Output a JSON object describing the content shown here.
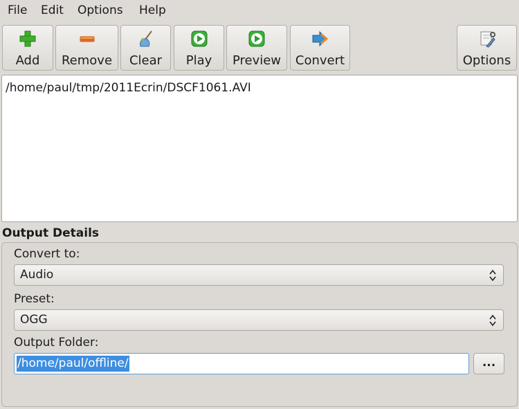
{
  "menubar": {
    "items": [
      "File",
      "Edit",
      "Options",
      "Help"
    ]
  },
  "toolbar": {
    "add_label": "Add",
    "remove_label": "Remove",
    "clear_label": "Clear",
    "play_label": "Play",
    "preview_label": "Preview",
    "convert_label": "Convert",
    "options_label": "Options"
  },
  "file_list": {
    "items": [
      "/home/paul/tmp/2011Ecrin/DSCF1061.AVI"
    ]
  },
  "output_details": {
    "title": "Output Details",
    "convert_to_label": "Convert to:",
    "convert_to_value": "Audio",
    "preset_label": "Preset:",
    "preset_value": "OGG",
    "output_folder_label": "Output Folder:",
    "output_folder_value": "/home/paul/offline/",
    "browse_label": "..."
  },
  "colors": {
    "window_bg": "#dedbd7",
    "selection": "#3d8ee0",
    "focus_border": "#5c9bd6"
  }
}
